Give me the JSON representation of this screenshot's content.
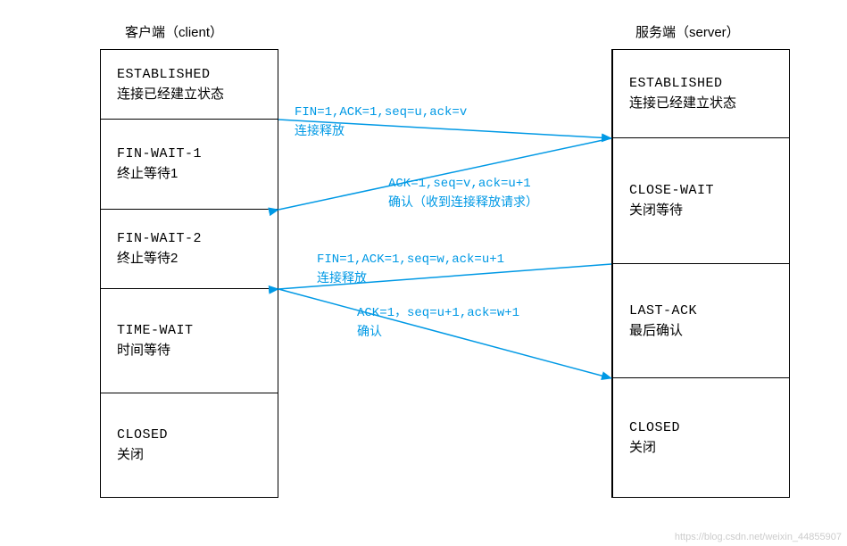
{
  "headers": {
    "client": "客户端（client）",
    "server": "服务端（server）"
  },
  "client_states": [
    {
      "code": "ESTABLISHED",
      "label": "连接已经建立状态"
    },
    {
      "code": "FIN-WAIT-1",
      "label": "终止等待1"
    },
    {
      "code": "FIN-WAIT-2",
      "label": "终止等待2"
    },
    {
      "code": "TIME-WAIT",
      "label": "时间等待"
    },
    {
      "code": "CLOSED",
      "label": "关闭"
    }
  ],
  "server_states": [
    {
      "code": "ESTABLISHED",
      "label": "连接已经建立状态"
    },
    {
      "code": "CLOSE-WAIT",
      "label": "关闭等待"
    },
    {
      "code": "LAST-ACK",
      "label": "最后确认"
    },
    {
      "code": "CLOSED",
      "label": "关闭"
    }
  ],
  "messages": {
    "m1": {
      "flags": "FIN=1,ACK=1,seq=u,ack=v",
      "desc": "连接释放"
    },
    "m2": {
      "flags": "ACK=1,seq=v,ack=u+1",
      "desc": "确认（收到连接释放请求）"
    },
    "m3": {
      "flags": "FIN=1,ACK=1,seq=w,ack=u+1",
      "desc": "连接释放"
    },
    "m4": {
      "flags": "ACK=1，seq=u+1,ack=w+1",
      "desc": "确认"
    }
  },
  "watermark": "https://blog.csdn.net/weixin_44855907"
}
